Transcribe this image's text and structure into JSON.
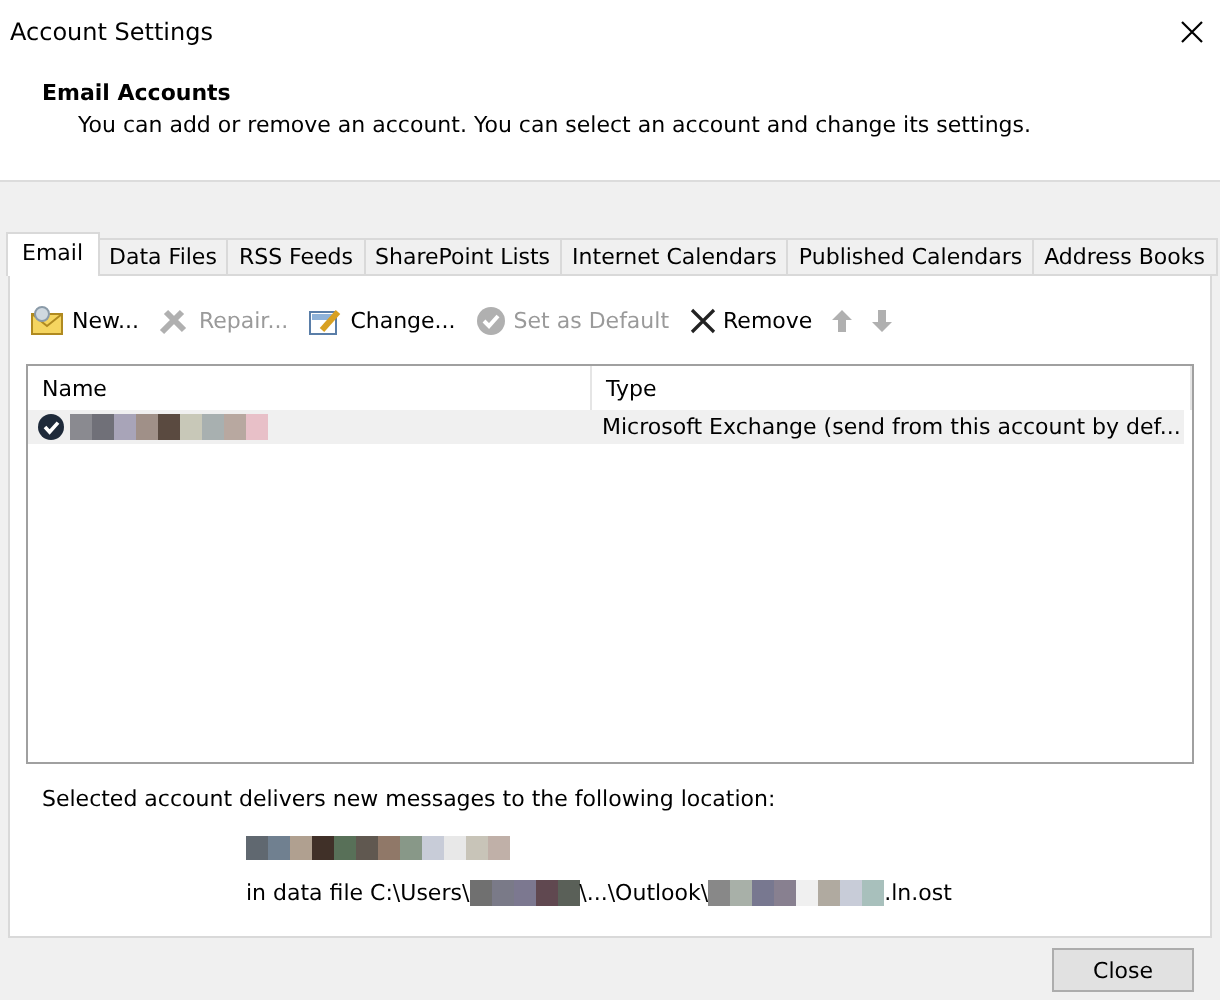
{
  "window": {
    "title": "Account Settings"
  },
  "header": {
    "title": "Email Accounts",
    "description": "You can add or remove an account. You can select an account and change its settings."
  },
  "tabs": [
    {
      "label": "Email",
      "selected": true
    },
    {
      "label": "Data Files",
      "selected": false
    },
    {
      "label": "RSS Feeds",
      "selected": false
    },
    {
      "label": "SharePoint Lists",
      "selected": false
    },
    {
      "label": "Internet Calendars",
      "selected": false
    },
    {
      "label": "Published Calendars",
      "selected": false
    },
    {
      "label": "Address Books",
      "selected": false
    }
  ],
  "toolbar": [
    {
      "kind": "new",
      "label": "New...",
      "disabled": false
    },
    {
      "kind": "repair",
      "label": "Repair...",
      "disabled": true
    },
    {
      "kind": "change",
      "label": "Change...",
      "disabled": false
    },
    {
      "kind": "default",
      "label": "Set as Default",
      "disabled": true
    },
    {
      "kind": "remove",
      "label": "Remove",
      "disabled": false
    },
    {
      "kind": "up",
      "disabled": true
    },
    {
      "kind": "down",
      "disabled": true
    }
  ],
  "table": {
    "columns": [
      "Name",
      "Type"
    ],
    "rows": [
      {
        "is_default": true,
        "selected": true,
        "type": "Microsoft Exchange (send from this account by def..."
      }
    ]
  },
  "location": {
    "label": "Selected account delivers new messages to the following location:",
    "path_start": "in data file C:\\Users\\",
    "path_middle": "\\...\\Outlook\\",
    "path_end": ".ln.ost"
  },
  "buttons": [
    {
      "label": "Close"
    }
  ]
}
